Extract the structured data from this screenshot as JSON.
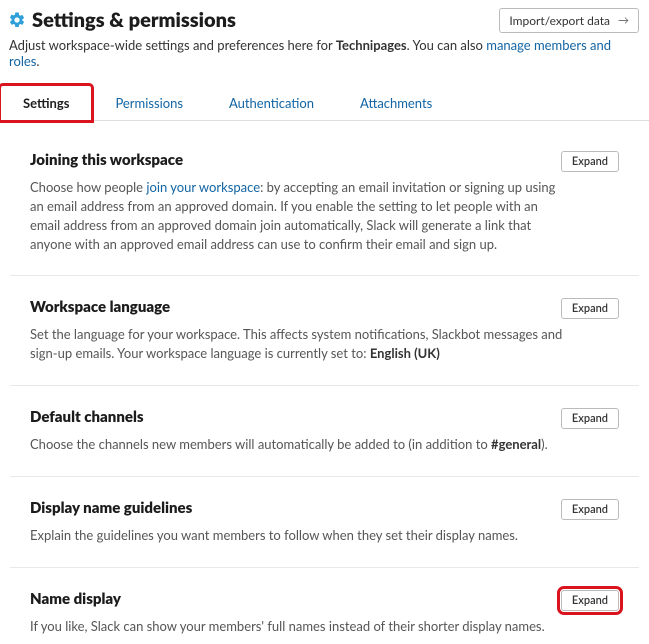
{
  "header": {
    "title": "Settings & permissions",
    "import_export_label": "Import/export data"
  },
  "subhead": {
    "pre": "Adjust workspace-wide settings and preferences here for ",
    "workspace_name": "Technipages",
    "mid": ". You can also ",
    "manage_link": "manage members and roles",
    "end": "."
  },
  "tabs": [
    {
      "id": "settings",
      "label": "Settings",
      "active": true
    },
    {
      "id": "permissions",
      "label": "Permissions",
      "active": false
    },
    {
      "id": "authentication",
      "label": "Authentication",
      "active": false
    },
    {
      "id": "attachments",
      "label": "Attachments",
      "active": false
    }
  ],
  "sections": {
    "joining": {
      "title": "Joining this workspace",
      "desc_pre": "Choose how people ",
      "desc_link": "join your workspace",
      "desc_post": ": by accepting an email invitation or signing up using an email address from an approved domain. If you enable the setting to let people with an email address from an approved domain join automatically, Slack will generate a link that anyone with an approved email address can use to confirm their email and sign up.",
      "expand": "Expand"
    },
    "language": {
      "title": "Workspace language",
      "desc_pre": "Set the language for your workspace. This affects system notifications, Slackbot messages and sign-up emails. Your workspace language is currently set to: ",
      "desc_bold": "English (UK)",
      "expand": "Expand"
    },
    "default_channels": {
      "title": "Default channels",
      "desc_pre": "Choose the channels new members will automatically be added to (in addition to ",
      "desc_bold": "#general",
      "desc_post": ").",
      "expand": "Expand"
    },
    "display_name": {
      "title": "Display name guidelines",
      "desc": "Explain the guidelines you want members to follow when they set their display names.",
      "expand": "Expand"
    },
    "name_display": {
      "title": "Name display",
      "desc": "If you like, Slack can show your members' full names instead of their shorter display names.",
      "expand": "Expand"
    }
  }
}
